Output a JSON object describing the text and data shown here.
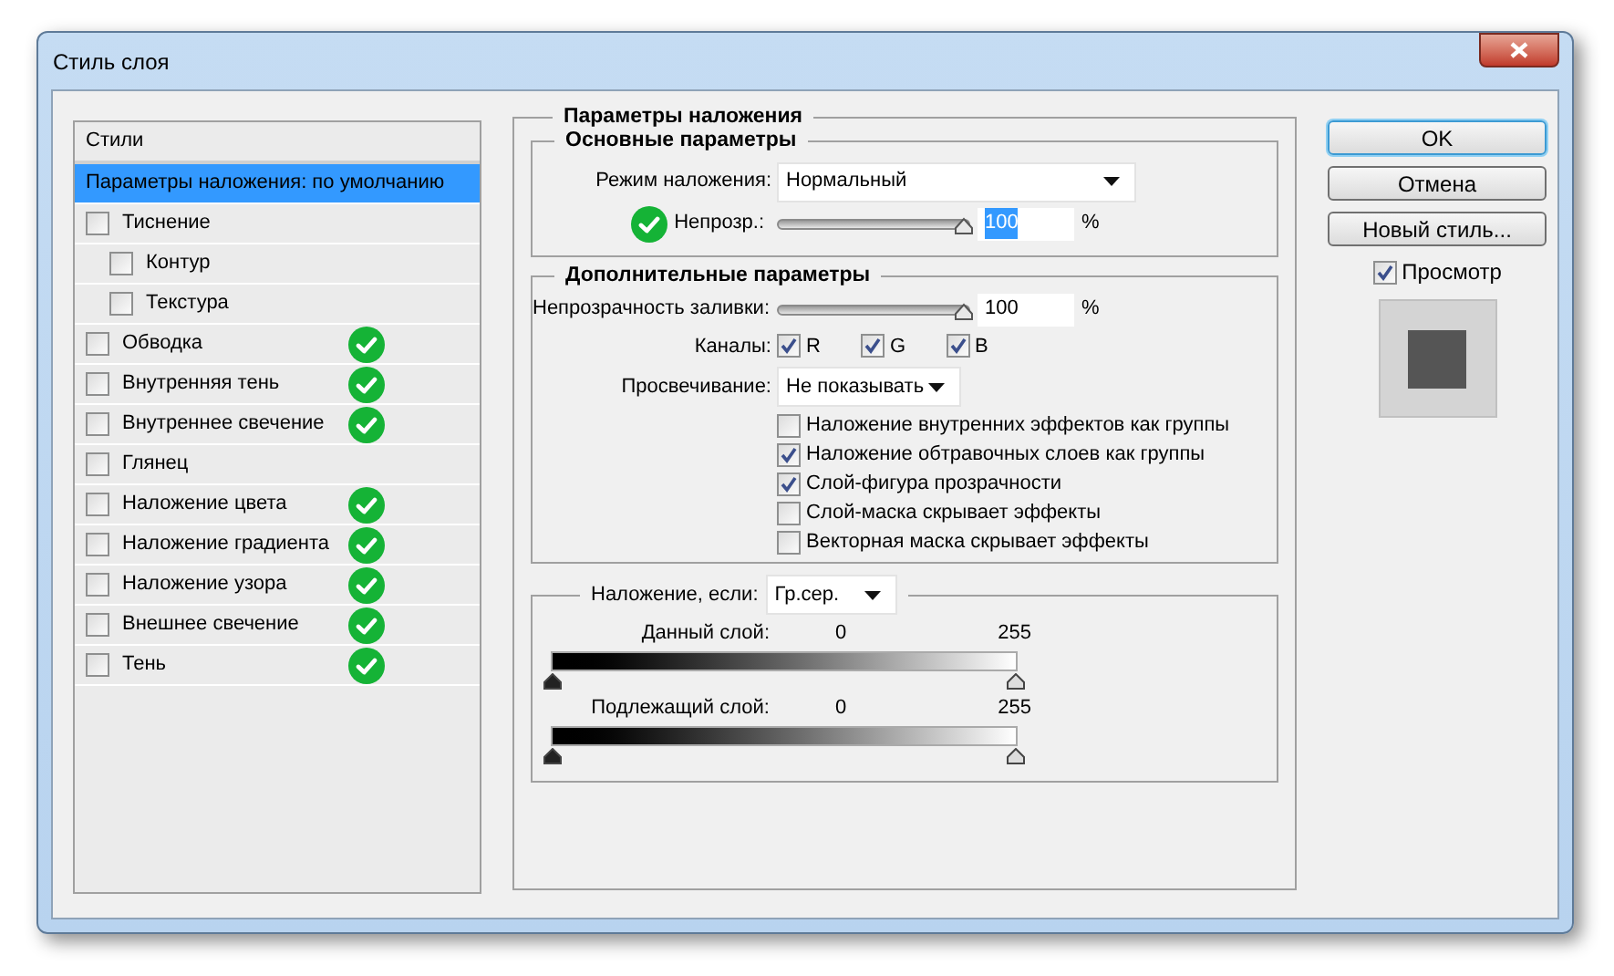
{
  "window": {
    "title": "Стиль слоя"
  },
  "styles_panel": {
    "header": "Стили",
    "items": [
      {
        "label": "Параметры наложения: по умолчанию",
        "kind": "plain",
        "selected": true,
        "fx_icon": false
      },
      {
        "label": "Тиснение",
        "kind": "checkbox",
        "selected": false,
        "checked": false,
        "fx_icon": false,
        "children": [
          {
            "label": "Контур",
            "kind": "checkbox",
            "selected": false,
            "checked": false,
            "fx_icon": false
          },
          {
            "label": "Текстура",
            "kind": "checkbox",
            "selected": false,
            "checked": false,
            "fx_icon": false
          }
        ]
      },
      {
        "label": "Обводка",
        "kind": "checkbox",
        "selected": false,
        "checked": false,
        "fx_icon": true
      },
      {
        "label": "Внутренняя тень",
        "kind": "checkbox",
        "selected": false,
        "checked": false,
        "fx_icon": true
      },
      {
        "label": "Внутреннее свечение",
        "kind": "checkbox",
        "selected": false,
        "checked": false,
        "fx_icon": true
      },
      {
        "label": "Глянец",
        "kind": "checkbox",
        "selected": false,
        "checked": false,
        "fx_icon": false
      },
      {
        "label": "Наложение цвета",
        "kind": "checkbox",
        "selected": false,
        "checked": false,
        "fx_icon": true
      },
      {
        "label": "Наложение градиента",
        "kind": "checkbox",
        "selected": false,
        "checked": false,
        "fx_icon": true
      },
      {
        "label": "Наложение узора",
        "kind": "checkbox",
        "selected": false,
        "checked": false,
        "fx_icon": true
      },
      {
        "label": "Внешнее свечение",
        "kind": "checkbox",
        "selected": false,
        "checked": false,
        "fx_icon": true
      },
      {
        "label": "Тень",
        "kind": "checkbox",
        "selected": false,
        "checked": false,
        "fx_icon": true
      }
    ]
  },
  "blending": {
    "title": "Параметры наложения",
    "general": {
      "title": "Основные параметры",
      "blend_mode": {
        "label": "Режим наложения:",
        "value": "Нормальный"
      },
      "opacity": {
        "label": "Непрозр.:",
        "fx_icon": true,
        "level": 1,
        "value": "100",
        "value_selected": true,
        "unit": "%"
      }
    },
    "advanced": {
      "title": "Дополнительные параметры",
      "fill_opacity": {
        "label": "Непрозрачность заливки:",
        "level": 1,
        "value": "100",
        "value_selected": false,
        "unit": "%"
      },
      "channels": {
        "label": "Каналы:",
        "items": [
          {
            "label": "R",
            "checked": true
          },
          {
            "label": "G",
            "checked": true
          },
          {
            "label": "B",
            "checked": true
          }
        ]
      },
      "knockout": {
        "label": "Просвечивание:",
        "value": "Не показывать"
      },
      "options": [
        {
          "label": "Наложение внутренних эффектов как группы",
          "checked": false
        },
        {
          "label": "Наложение обтравочных слоев как группы",
          "checked": true
        },
        {
          "label": "Слой-фигура прозрачности",
          "checked": true
        },
        {
          "label": "Слой-маска скрывает эффекты",
          "checked": false
        },
        {
          "label": "Векторная маска скрывает эффекты",
          "checked": false
        }
      ]
    },
    "blend_if": {
      "label": "Наложение, если:",
      "value": "Гр.сер.",
      "ranges": [
        {
          "label": "Данный слой:",
          "low": "0",
          "high": "255",
          "thumbs": [
            {
              "level": 0
            },
            {
              "level": 1
            }
          ]
        },
        {
          "label": "Подлежащий слой:",
          "low": "0",
          "high": "255",
          "thumbs": [
            {
              "level": 0
            },
            {
              "level": 1
            }
          ]
        }
      ]
    }
  },
  "buttons": [
    {
      "label": "OK",
      "default": true
    },
    {
      "label": "Отмена",
      "default": false
    },
    {
      "label": "Новый стиль...",
      "default": false
    }
  ],
  "preview": {
    "label": "Просмотр",
    "checked": true
  }
}
